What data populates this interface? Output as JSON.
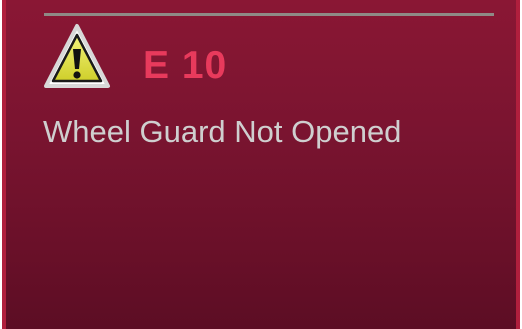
{
  "screen": {
    "warning_icon": "warning-triangle-icon",
    "error_code": "E 10",
    "error_message": "Wheel Guard Not Opened",
    "colors": {
      "background": "#7a1430",
      "error_code": "#e83a5c",
      "message_text": "#cfcfcf",
      "icon_fill": "#e6e64a"
    }
  }
}
